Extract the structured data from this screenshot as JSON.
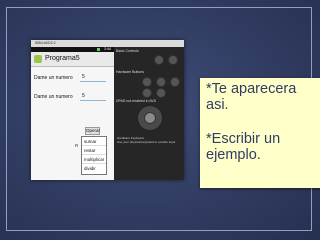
{
  "window": {
    "title": "5554:AVD2.2"
  },
  "app": {
    "title": "Programa5",
    "status_time": "2:44",
    "inputs": [
      {
        "label": "Dame un numero",
        "value": "5"
      },
      {
        "label": "Dame un numero",
        "value": "5"
      }
    ],
    "operar_button": "Operar",
    "partial_letter": "R",
    "menu_items": [
      "sumar",
      "restar",
      "multiplicar",
      "dividir"
    ]
  },
  "emulator": {
    "sections": [
      "Basic Controls",
      "Hardware Buttons",
      "DPAD not enabled in AVD"
    ],
    "keyboard_title": "Hardware Keyboard",
    "keyboard_note": "Use your physical keyboard to provide input"
  },
  "callout": {
    "line1": "*Te aparecera",
    "line2": "asi.",
    "line3": "*Escribir un",
    "line4": "ejemplo."
  },
  "colors": {
    "callout_bg": "#ffffc9",
    "callout_text": "#2f3d66"
  }
}
